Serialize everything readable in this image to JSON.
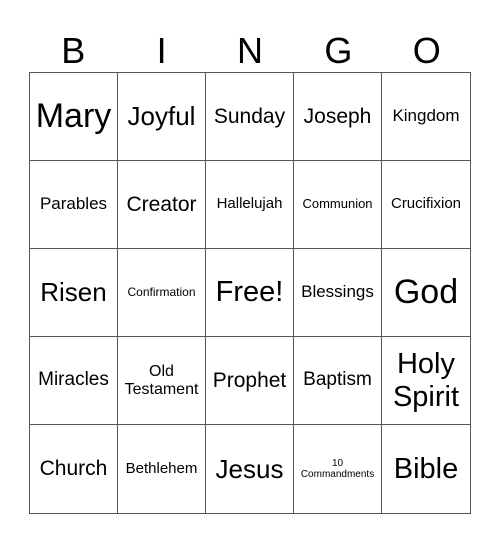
{
  "header": [
    "B",
    "I",
    "N",
    "G",
    "O"
  ],
  "cells": [
    "Mary",
    "Joyful",
    "Sunday",
    "Joseph",
    "Kingdom",
    "Parables",
    "Creator",
    "Hallelujah",
    "Communion",
    "Crucifixion",
    "Risen",
    "Confirmation",
    "Free!",
    "Blessings",
    "God",
    "Miracles",
    "Old Testament",
    "Prophet",
    "Baptism",
    "Holy Spirit",
    "Church",
    "Bethlehem",
    "Jesus",
    "10 Commandments",
    "Bible"
  ]
}
